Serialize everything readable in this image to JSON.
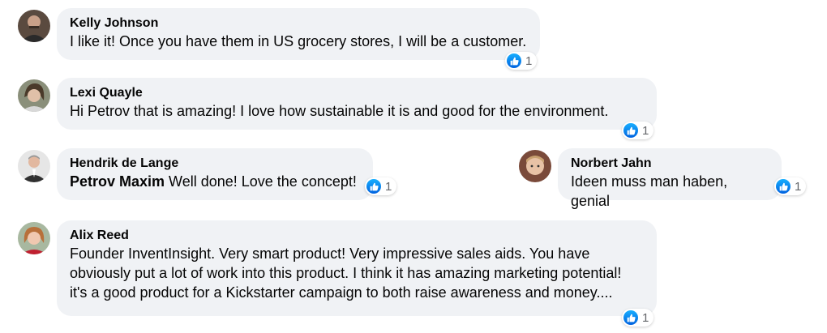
{
  "comments": [
    {
      "author": "Kelly Johnson",
      "text": "I like it! Once you have them in US grocery stores, I will be a customer.",
      "reaction": {
        "icon": "like-icon",
        "count": "1"
      }
    },
    {
      "author": "Lexi Quayle",
      "text": "Hi Petrov that is amazing! I love how sustainable it is and good for the environment.",
      "reaction": {
        "icon": "like-icon",
        "count": "1"
      }
    },
    {
      "author": "Hendrik de Lange",
      "mention": "Petrov Maxim",
      "text": " Well done! Love the concept!",
      "reaction": {
        "icon": "like-icon",
        "count": "1"
      }
    },
    {
      "author": "Norbert Jahn",
      "text": "Ideen muss man haben, genial",
      "reaction": {
        "icon": "like-icon",
        "count": "1"
      }
    },
    {
      "author": "Alix Reed",
      "text_lines": [
        "Founder InventInsight. Very smart product! Very impressive sales aids. You have",
        "obviously put a lot of work into this product. I think it has amazing marketing potential!",
        "it's a good product for a Kickstarter campaign to both raise awareness and money...."
      ],
      "reaction": {
        "icon": "like-icon",
        "count": "1"
      }
    }
  ],
  "colors": {
    "bubble": "#f0f2f5",
    "like_blue": "#1877f2",
    "count_gray": "#65676b"
  }
}
